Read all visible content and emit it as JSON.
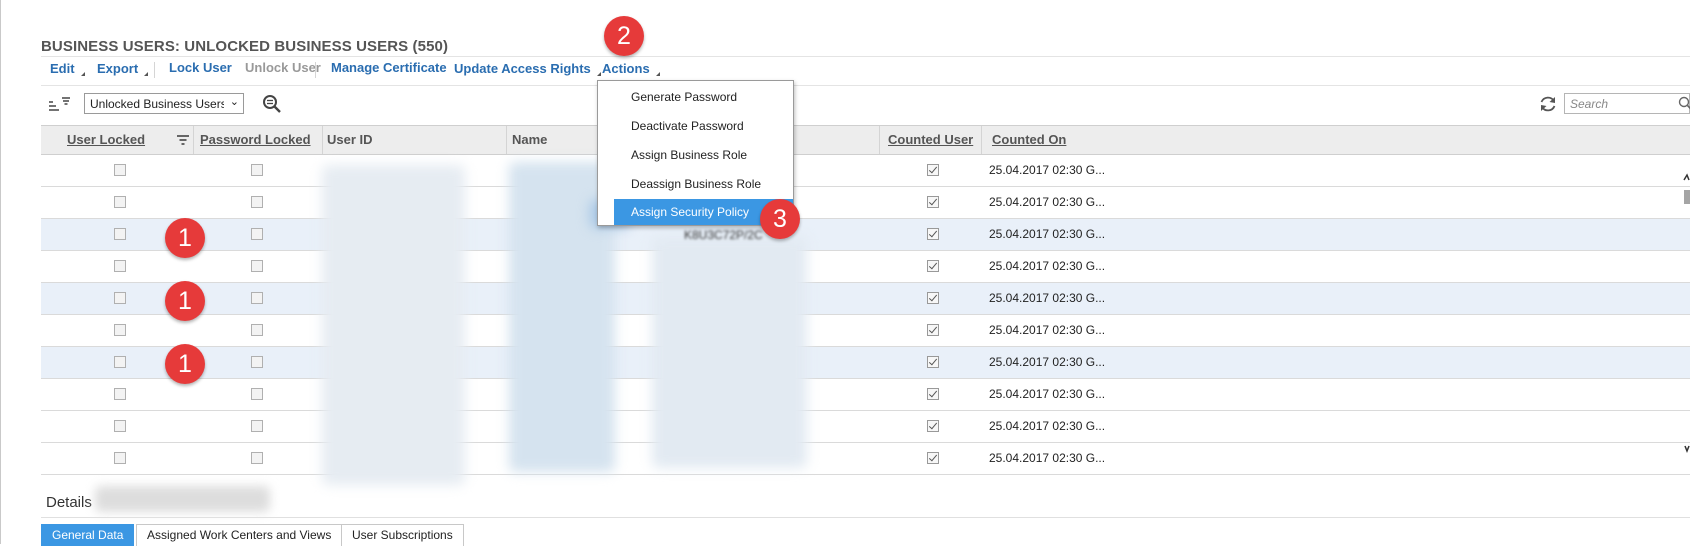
{
  "page": {
    "title": "BUSINESS USERS: UNLOCKED BUSINESS USERS (550)"
  },
  "toolbar": {
    "edit": "Edit",
    "export": "Export",
    "lock_user": "Lock User",
    "unlock_user": "Unlock User",
    "manage_certificate": "Manage Certificate",
    "update_access_rights": "Update Access Rights",
    "actions": "Actions"
  },
  "filter_bar": {
    "view_select_value": "Unlocked Business Users",
    "search_placeholder": "Search",
    "icons": [
      "sort-icon",
      "zoom-out-icon",
      "refresh-icon",
      "search-icon"
    ]
  },
  "table": {
    "columns": [
      "User Locked",
      "Password Locked",
      "User ID",
      "Name",
      "Counted User",
      "Counted On"
    ],
    "rows": [
      {
        "user_locked": false,
        "password_locked": false,
        "counted_user": true,
        "counted_on": "25.04.2017 02:30 G..."
      },
      {
        "user_locked": false,
        "password_locked": false,
        "counted_user": true,
        "counted_on": "25.04.2017 02:30 G..."
      },
      {
        "user_locked": false,
        "password_locked": false,
        "counted_user": true,
        "counted_on": "25.04.2017 02:30 G..."
      },
      {
        "user_locked": false,
        "password_locked": false,
        "counted_user": true,
        "counted_on": "25.04.2017 02:30 G..."
      },
      {
        "user_locked": false,
        "password_locked": false,
        "counted_user": true,
        "counted_on": "25.04.2017 02:30 G..."
      },
      {
        "user_locked": false,
        "password_locked": false,
        "counted_user": true,
        "counted_on": "25.04.2017 02:30 G..."
      },
      {
        "user_locked": false,
        "password_locked": false,
        "counted_user": true,
        "counted_on": "25.04.2017 02:30 G..."
      },
      {
        "user_locked": false,
        "password_locked": false,
        "counted_user": true,
        "counted_on": "25.04.2017 02:30 G..."
      },
      {
        "user_locked": false,
        "password_locked": false,
        "counted_user": true,
        "counted_on": "25.04.2017 02:30 G..."
      },
      {
        "user_locked": false,
        "password_locked": false,
        "counted_user": true,
        "counted_on": "25.04.2017 02:30 G..."
      }
    ],
    "partial_text": "K8U3C72P/2C"
  },
  "actions_menu": {
    "items": [
      "Generate Password",
      "Deactivate Password",
      "Assign Business Role",
      "Deassign Business Role",
      "Assign Security Policy"
    ],
    "selected": "Assign Security Policy"
  },
  "annotations": {
    "badge_1": "1",
    "badge_2": "2",
    "badge_3": "3"
  },
  "details": {
    "label": "Details",
    "tabs": [
      "General Data",
      "Assigned Work Centers and Views",
      "User Subscriptions"
    ],
    "active_tab": "General Data"
  },
  "colors": {
    "link": "#2a6db0",
    "selection": "#3b97e3",
    "row_alt": "#e9f0f9",
    "badge": "#e63a3a"
  }
}
